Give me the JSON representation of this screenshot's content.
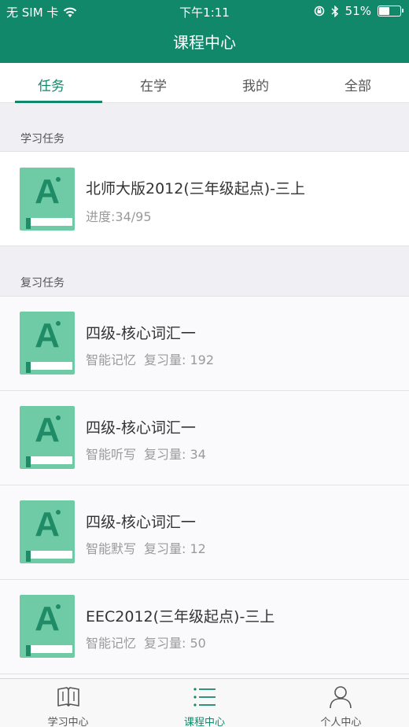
{
  "status_bar": {
    "carrier": "无 SIM 卡",
    "time": "下午1:11",
    "battery": "51%",
    "battery_level": 0.51
  },
  "nav": {
    "title": "课程中心"
  },
  "tabs": [
    {
      "label": "任务",
      "active": true
    },
    {
      "label": "在学",
      "active": false
    },
    {
      "label": "我的",
      "active": false
    },
    {
      "label": "全部",
      "active": false
    }
  ],
  "study_section": {
    "header": "学习任务",
    "items": [
      {
        "title": "北师大版2012(三年级起点)-三上",
        "progress": "进度:34/95"
      }
    ]
  },
  "review_section": {
    "header": "复习任务",
    "items": [
      {
        "title": "四级-核心词汇一",
        "mode": "智能记忆",
        "review_count": "复习量: 192"
      },
      {
        "title": "四级-核心词汇一",
        "mode": "智能听写",
        "review_count": "复习量: 34"
      },
      {
        "title": "四级-核心词汇一",
        "mode": "智能默写",
        "review_count": "复习量: 12"
      },
      {
        "title": "EEC2012(三年级起点)-三上",
        "mode": "智能记忆",
        "review_count": "复习量: 50"
      }
    ]
  },
  "book_letter": "A",
  "bottom_nav": [
    {
      "label": "学习中心",
      "icon": "open-book-icon",
      "active": false
    },
    {
      "label": "课程中心",
      "icon": "list-icon",
      "active": true
    },
    {
      "label": "个人中心",
      "icon": "person-icon",
      "active": false
    }
  ],
  "colors": {
    "brand": "#12886a",
    "book_cover": "#6fcba6",
    "book_accent": "#1f8c67"
  }
}
